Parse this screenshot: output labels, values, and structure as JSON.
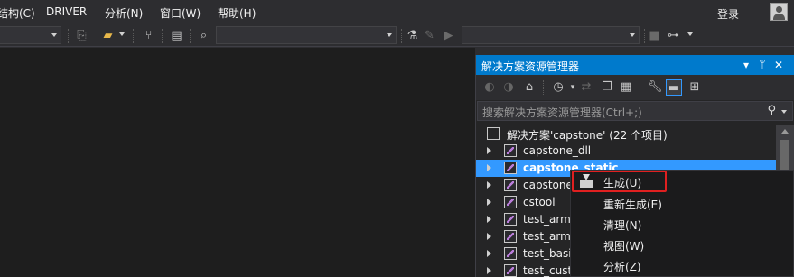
{
  "menubar": {
    "items": [
      "结构(C)",
      "DRIVER",
      "分析(N)",
      "窗口(W)",
      "帮助(H)"
    ],
    "login": "登录"
  },
  "solution_explorer": {
    "title": "解决方案资源管理器",
    "title_buttons": [
      "▾",
      "ᛘ",
      "✕"
    ],
    "search_placeholder": "搜索解决方案资源管理器(Ctrl+;)",
    "solution_label": "解决方案'capstone' (22 个项目)",
    "projects": [
      {
        "label": "capstone_dll",
        "selected": false
      },
      {
        "label": "capstone_static",
        "selected": true
      },
      {
        "label": "capstone",
        "selected": false
      },
      {
        "label": "cstool",
        "selected": false
      },
      {
        "label": "test_arm",
        "selected": false
      },
      {
        "label": "test_arm6",
        "selected": false
      },
      {
        "label": "test_basic",
        "selected": false
      },
      {
        "label": "test_custo",
        "selected": false
      }
    ]
  },
  "context_menu": {
    "items": [
      "生成(U)",
      "重新生成(E)",
      "清理(N)",
      "视图(W)",
      "分析(Z)"
    ]
  },
  "colors": {
    "accent": "#007acc",
    "selection": "#3399ff",
    "highlight_box": "#e02020"
  }
}
